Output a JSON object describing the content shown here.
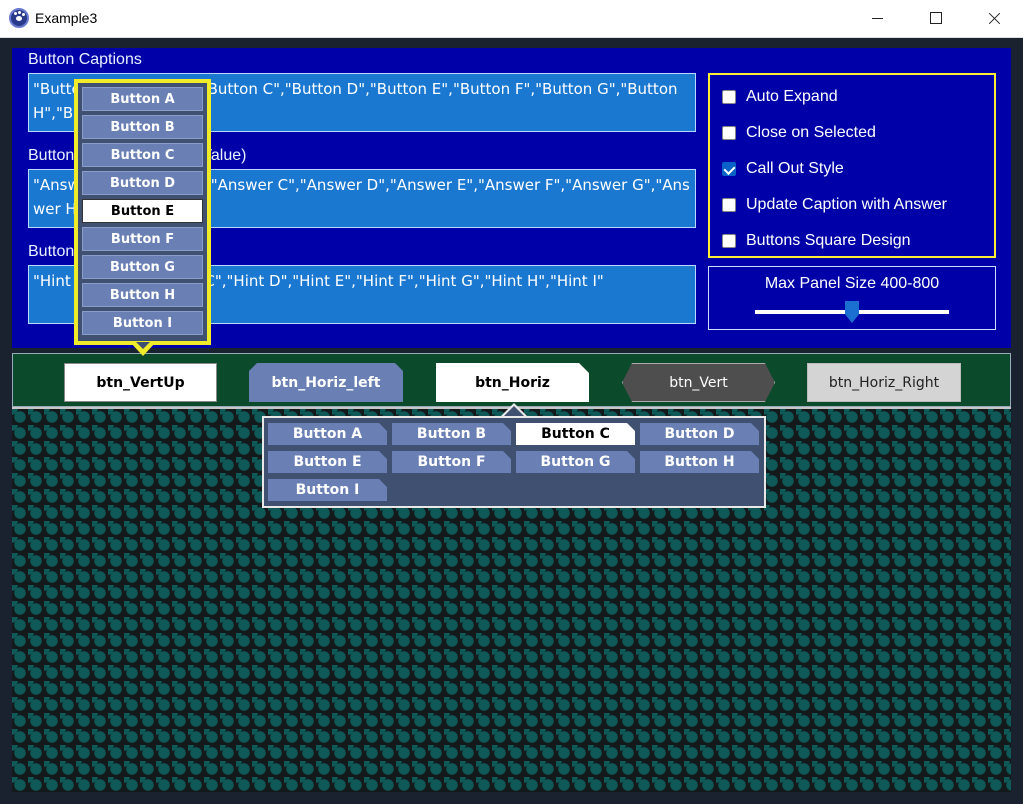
{
  "window": {
    "title": "Example3"
  },
  "fields": [
    {
      "label": "Button Captions",
      "value": "\"Button A\",\"Button B\",\"Button C\",\"Button D\",\"Button E\",\"Button F\",\"Button G\",\"Button H\",\"Button I\""
    },
    {
      "label": "Button Answers (Return Value)",
      "value": "\"Answer A\",\"Answer B\",\"Answer C\",\"Answer D\",\"Answer E\",\"Answer F\",\"Answer G\",\"Answer H\",\"Answer I\""
    },
    {
      "label": "Button Hints",
      "value": "\"Hint A\",\"Hint B\",\"Hint C\",\"Hint D\",\"Hint E\",\"Hint F\",\"Hint G\",\"Hint H\",\"Hint I\""
    }
  ],
  "options": [
    {
      "label": "Auto Expand",
      "checked": false
    },
    {
      "label": "Close on Selected",
      "checked": false
    },
    {
      "label": "Call Out Style",
      "checked": true
    },
    {
      "label": "Update Caption with Answer",
      "checked": false
    },
    {
      "label": "Buttons Square Design",
      "checked": false
    }
  ],
  "slider": {
    "label": "Max Panel Size 400-800",
    "value": 600,
    "min": 400,
    "max": 800
  },
  "demo_buttons": {
    "vert_up": "btn_VertUp",
    "horiz_left": "btn_Horiz_left",
    "horiz": "btn_Horiz",
    "vert": "btn_Vert",
    "horiz_right": "btn_Horiz_Right"
  },
  "vertical_popup": {
    "items": [
      "Button A",
      "Button B",
      "Button C",
      "Button D",
      "Button E",
      "Button F",
      "Button G",
      "Button H",
      "Button I"
    ],
    "selected_index": 4
  },
  "horizontal_popup": {
    "items": [
      "Button A",
      "Button B",
      "Button C",
      "Button D",
      "Button E",
      "Button F",
      "Button G",
      "Button H",
      "Button I"
    ],
    "selected_index": 2
  }
}
